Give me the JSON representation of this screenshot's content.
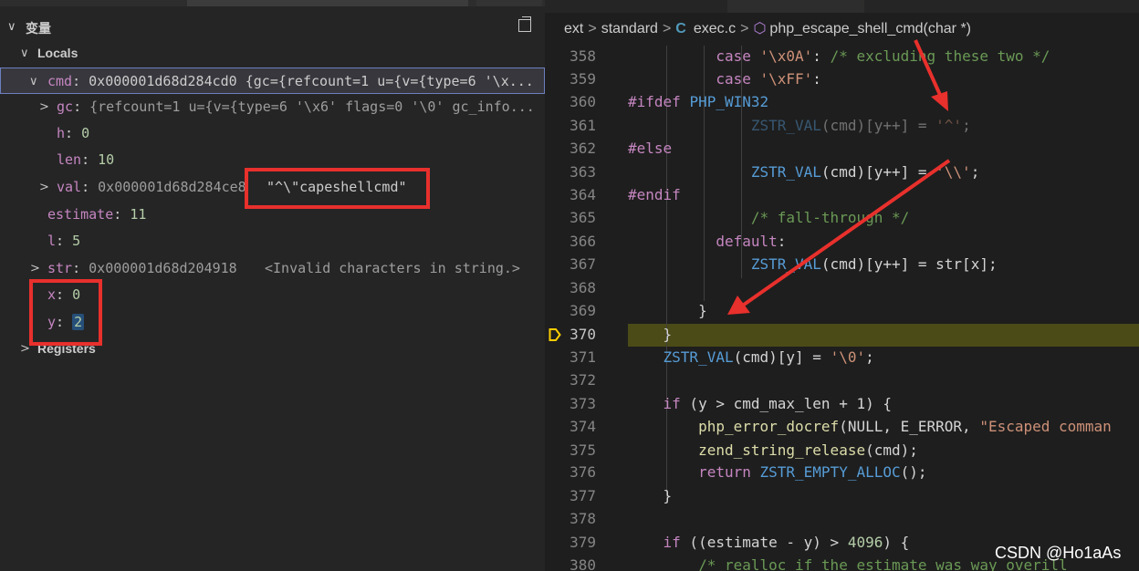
{
  "panel": {
    "title": "变量"
  },
  "locals": {
    "label": "Locals"
  },
  "variables": {
    "cmd": {
      "name": "cmd",
      "value": "0x000001d68d284cd0 {gc={refcount=1 u={v={type=6 '\\x..."
    },
    "gc": {
      "name": "gc",
      "value": "{refcount=1 u={v={type=6 '\\x6' flags=0 '\\0' gc_info..."
    },
    "h": {
      "name": "h",
      "value": "0"
    },
    "len": {
      "name": "len",
      "value": "10"
    },
    "val": {
      "name": "val",
      "value": "0x000001d68d284ce8",
      "string": "\"^\\\"capeshellcmd\""
    },
    "estimate": {
      "name": "estimate",
      "value": "11"
    },
    "l": {
      "name": "l",
      "value": "5"
    },
    "str": {
      "name": "str",
      "value": "0x000001d68d204918",
      "note": "<Invalid characters in string.>"
    },
    "x": {
      "name": "x",
      "value": "0"
    },
    "y": {
      "name": "y",
      "value": "2"
    }
  },
  "registers": {
    "label": "Registers"
  },
  "breadcrumb": {
    "folder1": "ext",
    "folder2": "standard",
    "file_icon": "C",
    "file": "exec.c",
    "symbol": "php_escape_shell_cmd(char *)"
  },
  "editor": {
    "line_numbers": [
      "358",
      "359",
      "360",
      "361",
      "362",
      "363",
      "364",
      "365",
      "366",
      "367",
      "368",
      "369",
      "370",
      "371",
      "372",
      "373",
      "374",
      "375",
      "376",
      "377",
      "378",
      "379",
      "380"
    ],
    "current_line": "370",
    "tokens": {
      "case": "case",
      "x0a": "'\\x0A'",
      "c358": "/* excluding these two */",
      "xff": "'\\xFF'",
      "colon": ":",
      "ifdef": "#ifdef",
      "win32": "PHP_WIN32",
      "zstr": "ZSTR_VAL",
      "cmd_y_pp": "(cmd)[y++]",
      "assign": " = ",
      "caret": "'^'",
      "semi": ";",
      "else": "#else",
      "bslash": "'\\\\'",
      "endif": "#endif",
      "fallthrough": "/* fall-through */",
      "default": "default",
      "strx": "str[x];",
      "brace_close": "}",
      "cmd_y": "(cmd)[y]",
      "nul": "'\\0'",
      "if": "if",
      "cond373": " (y > cmd_max_len + 1) {",
      "docref": "php_error_docref",
      "null_arg": "(NULL, E_ERROR, ",
      "escaped": "\"Escaped comman",
      "release": "zend_string_release",
      "cmd_arg": "(cmd);",
      "return": "return",
      "empty": "ZSTR_EMPTY_ALLOC",
      "call_end": "();",
      "cond379a": " ((estimate - y) > ",
      "n4096": "4096",
      "cond379b": ") {",
      "c380": "/* realloc if the estimate was way overill"
    }
  },
  "watermark": "CSDN @Ho1aAs",
  "colors": {
    "highlight_box": "#e8302c",
    "current_line": "#4b4b18",
    "arrow": "#e8302c"
  }
}
